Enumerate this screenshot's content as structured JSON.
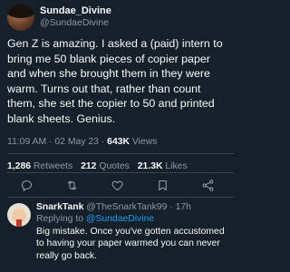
{
  "tweet": {
    "display_name": "Sundae_Divine",
    "handle": "@SundaeDivine",
    "text": "Gen Z is amazing. I asked a (paid) intern to bring me 50 blank pieces of copier paper and when she brought them in they were warm. Turns out that, rather than count them, she set the copier to 50 and printed blank sheets. Genius.",
    "time": "11:09 AM",
    "date": "02 May 23",
    "views_count": "643K",
    "views_label": "Views",
    "separator": "·"
  },
  "stats": {
    "retweets_count": "1,286",
    "retweets_label": "Retweets",
    "quotes_count": "212",
    "quotes_label": "Quotes",
    "likes_count": "21.3K",
    "likes_label": "Likes"
  },
  "actions": {
    "icons": [
      "reply-icon",
      "retweet-icon",
      "like-icon",
      "bookmark-icon",
      "share-icon"
    ]
  },
  "reply": {
    "display_name": "SnarkTank",
    "handle": "@TheSnarkTank99",
    "separator": "·",
    "age": "17h",
    "replying_label": "Replying to",
    "replying_to": "@SundaeDivine",
    "text": "Big mistake. Once you've gotten accustomed to having your paper warmed you can never really go back."
  },
  "colors": {
    "background": "#15202b",
    "text": "#f7f9f9",
    "muted": "#8b98a5",
    "accent": "#1d9bf0",
    "divider": "#38444d"
  }
}
